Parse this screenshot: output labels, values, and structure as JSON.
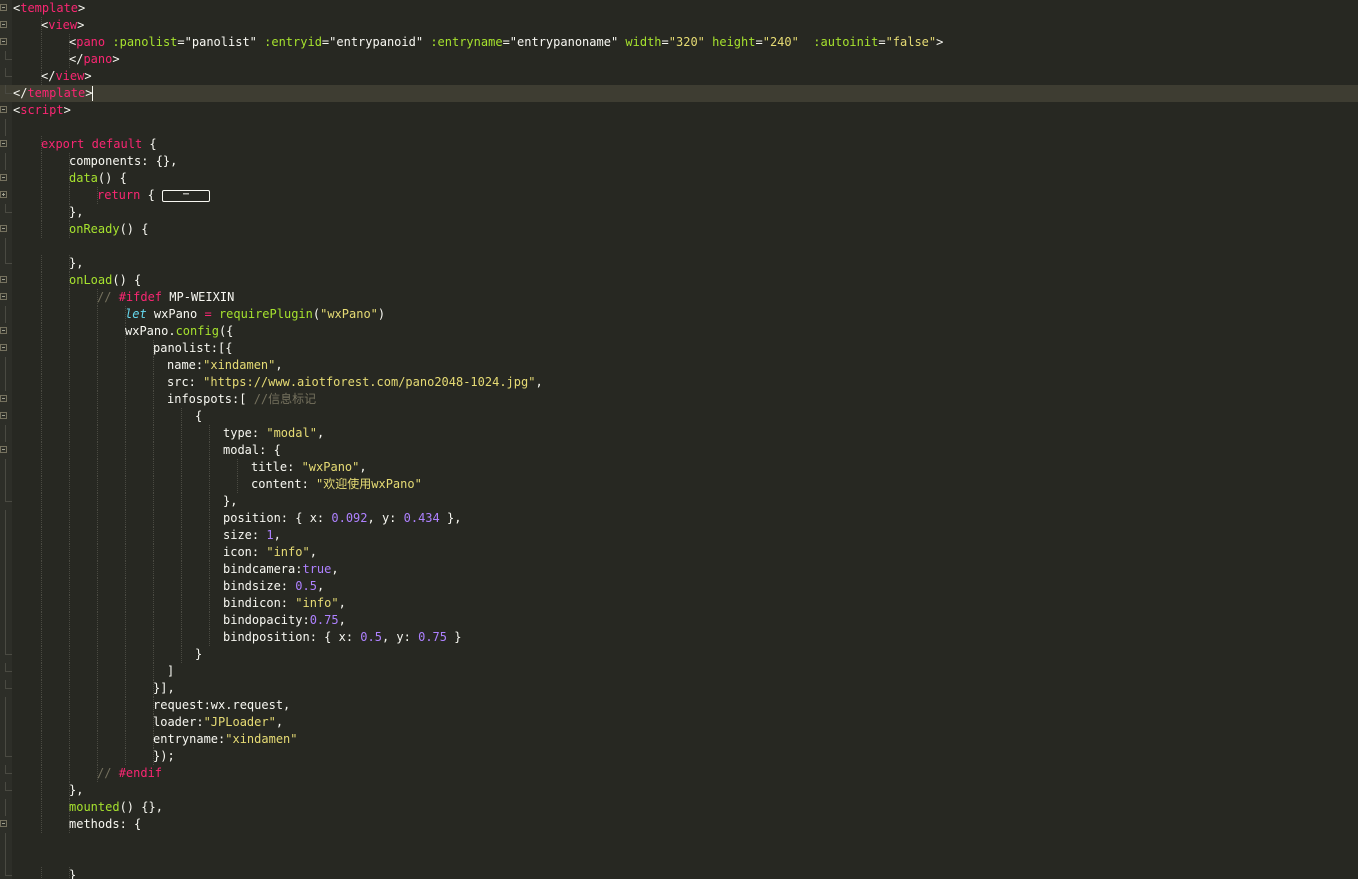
{
  "editor": {
    "tab_size_px": 28,
    "lines": [
      {
        "indent": 0,
        "fold": "open",
        "tokens": [
          [
            "punc",
            "<"
          ],
          [
            "tag",
            "template"
          ],
          [
            "punc",
            ">"
          ]
        ]
      },
      {
        "indent": 1,
        "fold": "open",
        "tokens": [
          [
            "punc",
            "<"
          ],
          [
            "tag",
            "view"
          ],
          [
            "punc",
            ">"
          ]
        ]
      },
      {
        "indent": 2,
        "fold": "open",
        "tokens": [
          [
            "punc",
            "<"
          ],
          [
            "tag",
            "pano"
          ],
          [
            "punc",
            " "
          ],
          [
            "attr",
            ":panolist"
          ],
          [
            "punc",
            "="
          ],
          [
            "punc",
            "\"panolist\""
          ],
          [
            "punc",
            " "
          ],
          [
            "attr",
            ":entryid"
          ],
          [
            "punc",
            "="
          ],
          [
            "punc",
            "\"entrypanoid\""
          ],
          [
            "punc",
            " "
          ],
          [
            "attr",
            ":entryname"
          ],
          [
            "punc",
            "="
          ],
          [
            "punc",
            "\"entrypanoname\""
          ],
          [
            "punc",
            " "
          ],
          [
            "attr",
            "width"
          ],
          [
            "punc",
            "="
          ],
          [
            "str",
            "\"320\""
          ],
          [
            "punc",
            " "
          ],
          [
            "attr",
            "height"
          ],
          [
            "punc",
            "="
          ],
          [
            "str",
            "\"240\""
          ],
          [
            "punc",
            "  "
          ],
          [
            "attr",
            ":autoinit"
          ],
          [
            "punc",
            "="
          ],
          [
            "str",
            "\"false\""
          ],
          [
            "punc",
            ">"
          ]
        ]
      },
      {
        "indent": 2,
        "fold": "end",
        "tokens": [
          [
            "punc",
            "</"
          ],
          [
            "tag",
            "pano"
          ],
          [
            "punc",
            ">"
          ]
        ]
      },
      {
        "indent": 1,
        "fold": "end",
        "tokens": [
          [
            "punc",
            "</"
          ],
          [
            "tag",
            "view"
          ],
          [
            "punc",
            ">"
          ]
        ]
      },
      {
        "indent": 0,
        "fold": "end",
        "current": true,
        "cursor": true,
        "tokens": [
          [
            "punc",
            "</"
          ],
          [
            "tag",
            "template"
          ],
          [
            "punc",
            ">"
          ]
        ]
      },
      {
        "indent": 0,
        "fold": "open",
        "tokens": [
          [
            "punc",
            "<"
          ],
          [
            "tag",
            "script"
          ],
          [
            "punc",
            ">"
          ]
        ]
      },
      {
        "indent": 0,
        "fold": "line",
        "tokens": []
      },
      {
        "indent": 1,
        "fold": "open",
        "tokens": [
          [
            "kw",
            "export"
          ],
          [
            "punc",
            " "
          ],
          [
            "kw",
            "default"
          ],
          [
            "punc",
            " {"
          ]
        ]
      },
      {
        "indent": 2,
        "fold": "line",
        "tokens": [
          [
            "punc",
            "components: {},"
          ]
        ]
      },
      {
        "indent": 2,
        "fold": "open",
        "tokens": [
          [
            "fn",
            "data"
          ],
          [
            "punc",
            "() {"
          ]
        ]
      },
      {
        "indent": 3,
        "fold": "closed",
        "collapsed": "⋯",
        "tokens": [
          [
            "kw",
            "return"
          ],
          [
            "punc",
            " { "
          ]
        ]
      },
      {
        "indent": 2,
        "fold": "end",
        "tokens": [
          [
            "punc",
            "},"
          ]
        ]
      },
      {
        "indent": 2,
        "fold": "open",
        "tokens": [
          [
            "fn",
            "onReady"
          ],
          [
            "punc",
            "() {"
          ]
        ]
      },
      {
        "indent": 0,
        "fold": "line",
        "tokens": []
      },
      {
        "indent": 2,
        "fold": "end",
        "tokens": [
          [
            "punc",
            "},"
          ]
        ]
      },
      {
        "indent": 2,
        "fold": "open",
        "tokens": [
          [
            "fn",
            "onLoad"
          ],
          [
            "punc",
            "() {"
          ]
        ]
      },
      {
        "indent": 3,
        "fold": "open",
        "tokens": [
          [
            "cm",
            "// "
          ],
          [
            "kw",
            "#ifdef"
          ],
          [
            "punc",
            " MP-WEIXIN"
          ]
        ]
      },
      {
        "indent": 4,
        "fold": "line",
        "tokens": [
          [
            "it",
            "let"
          ],
          [
            "punc",
            " wxPano "
          ],
          [
            "kw",
            "="
          ],
          [
            "punc",
            " "
          ],
          [
            "fn",
            "requirePlugin"
          ],
          [
            "punc",
            "("
          ],
          [
            "str",
            "\"wxPano\""
          ],
          [
            "punc",
            ")"
          ]
        ]
      },
      {
        "indent": 4,
        "fold": "open",
        "tokens": [
          [
            "punc",
            "wxPano."
          ],
          [
            "fn",
            "config"
          ],
          [
            "punc",
            "({"
          ]
        ]
      },
      {
        "indent": 5,
        "fold": "open",
        "tokens": [
          [
            "punc",
            "panolist:[{"
          ]
        ]
      },
      {
        "indent": 5.5,
        "fold": "line",
        "tokens": [
          [
            "punc",
            "name:"
          ],
          [
            "str",
            "\"xindamen\""
          ],
          [
            "punc",
            ","
          ]
        ]
      },
      {
        "indent": 5.5,
        "fold": "line",
        "tokens": [
          [
            "punc",
            "src: "
          ],
          [
            "str",
            "\"https://www.aiotforest.com/pano2048-1024.jpg\""
          ],
          [
            "punc",
            ","
          ]
        ]
      },
      {
        "indent": 5.5,
        "fold": "open",
        "tokens": [
          [
            "punc",
            "infospots:[ "
          ],
          [
            "cm",
            "//信息标记"
          ]
        ]
      },
      {
        "indent": 6.5,
        "fold": "open",
        "tokens": [
          [
            "punc",
            "{"
          ]
        ]
      },
      {
        "indent": 7.5,
        "fold": "line",
        "tokens": [
          [
            "punc",
            "type: "
          ],
          [
            "str",
            "\"modal\""
          ],
          [
            "punc",
            ","
          ]
        ]
      },
      {
        "indent": 7.5,
        "fold": "open",
        "tokens": [
          [
            "punc",
            "modal: {"
          ]
        ]
      },
      {
        "indent": 8.5,
        "fold": "line",
        "tokens": [
          [
            "punc",
            "title: "
          ],
          [
            "str",
            "\"wxPano\""
          ],
          [
            "punc",
            ","
          ]
        ]
      },
      {
        "indent": 8.5,
        "fold": "line",
        "tokens": [
          [
            "punc",
            "content: "
          ],
          [
            "str",
            "\"欢迎使用wxPano\""
          ]
        ]
      },
      {
        "indent": 7.5,
        "fold": "end",
        "tokens": [
          [
            "punc",
            "},"
          ]
        ]
      },
      {
        "indent": 7.5,
        "fold": "line",
        "tokens": [
          [
            "punc",
            "position: { x: "
          ],
          [
            "num",
            "0.092"
          ],
          [
            "punc",
            ", y: "
          ],
          [
            "num",
            "0.434"
          ],
          [
            "punc",
            " },"
          ]
        ]
      },
      {
        "indent": 7.5,
        "fold": "line",
        "tokens": [
          [
            "punc",
            "size: "
          ],
          [
            "num",
            "1"
          ],
          [
            "punc",
            ","
          ]
        ]
      },
      {
        "indent": 7.5,
        "fold": "line",
        "tokens": [
          [
            "punc",
            "icon: "
          ],
          [
            "str",
            "\"info\""
          ],
          [
            "punc",
            ","
          ]
        ]
      },
      {
        "indent": 7.5,
        "fold": "line",
        "tokens": [
          [
            "punc",
            "bindcamera:"
          ],
          [
            "num",
            "true"
          ],
          [
            "punc",
            ","
          ]
        ]
      },
      {
        "indent": 7.5,
        "fold": "line",
        "tokens": [
          [
            "punc",
            "bindsize: "
          ],
          [
            "num",
            "0.5"
          ],
          [
            "punc",
            ","
          ]
        ]
      },
      {
        "indent": 7.5,
        "fold": "line",
        "tokens": [
          [
            "punc",
            "bindicon: "
          ],
          [
            "str",
            "\"info\""
          ],
          [
            "punc",
            ","
          ]
        ]
      },
      {
        "indent": 7.5,
        "fold": "line",
        "tokens": [
          [
            "punc",
            "bindopacity:"
          ],
          [
            "num",
            "0.75"
          ],
          [
            "punc",
            ","
          ]
        ]
      },
      {
        "indent": 7.5,
        "fold": "line",
        "tokens": [
          [
            "punc",
            "bindposition: { x: "
          ],
          [
            "num",
            "0.5"
          ],
          [
            "punc",
            ", y: "
          ],
          [
            "num",
            "0.75"
          ],
          [
            "punc",
            " }"
          ]
        ]
      },
      {
        "indent": 6.5,
        "fold": "end",
        "tokens": [
          [
            "punc",
            "}"
          ]
        ]
      },
      {
        "indent": 5.5,
        "fold": "end",
        "tokens": [
          [
            "punc",
            "]"
          ]
        ]
      },
      {
        "indent": 5,
        "fold": "end",
        "tokens": [
          [
            "punc",
            "}],"
          ]
        ]
      },
      {
        "indent": 5,
        "fold": "line",
        "tokens": [
          [
            "punc",
            "request:wx.request,"
          ]
        ]
      },
      {
        "indent": 5,
        "fold": "line",
        "tokens": [
          [
            "punc",
            "loader:"
          ],
          [
            "str",
            "\"JPLoader\""
          ],
          [
            "punc",
            ","
          ]
        ]
      },
      {
        "indent": 5,
        "fold": "line",
        "tokens": [
          [
            "punc",
            "entryname:"
          ],
          [
            "str",
            "\"xindamen\""
          ]
        ]
      },
      {
        "indent": 5,
        "fold": "end",
        "tokens": [
          [
            "punc",
            "});"
          ]
        ]
      },
      {
        "indent": 3,
        "fold": "end",
        "tokens": [
          [
            "cm",
            "// "
          ],
          [
            "kw",
            "#endif"
          ]
        ]
      },
      {
        "indent": 2,
        "fold": "end",
        "tokens": [
          [
            "punc",
            "},"
          ]
        ]
      },
      {
        "indent": 2,
        "fold": "line",
        "tokens": [
          [
            "fn",
            "mounted"
          ],
          [
            "punc",
            "() {},"
          ]
        ]
      },
      {
        "indent": 2,
        "fold": "open",
        "tokens": [
          [
            "punc",
            "methods: {"
          ]
        ]
      },
      {
        "indent": 0,
        "fold": "line",
        "tokens": []
      },
      {
        "indent": 0,
        "fold": "line",
        "tokens": []
      },
      {
        "indent": 2,
        "fold": "end",
        "tokens": [
          [
            "punc",
            "}"
          ]
        ]
      }
    ]
  }
}
